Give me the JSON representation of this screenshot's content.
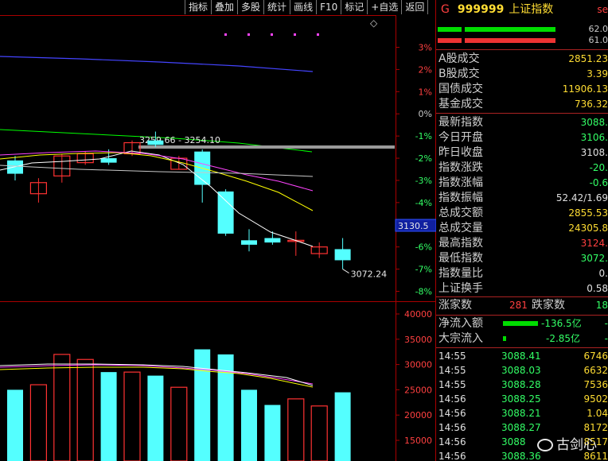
{
  "toolbar": [
    "指标",
    "叠加",
    "多股",
    "统计",
    "画线",
    "F10",
    "标记",
    "+自选",
    "返回"
  ],
  "main_chart": {
    "pct_labels": [
      "3%",
      "2%",
      "1%",
      "0%",
      "-1%",
      "-2%",
      "-3%",
      "-4%",
      "-5%",
      "-6%",
      "-7%",
      "-8%"
    ],
    "range_annotation": "3259.66 - 3254.10",
    "low_annotation": "3072.24",
    "cursor_price": "3130.5",
    "diamond": "◇"
  },
  "volume_chart": {
    "axis_labels": [
      "40000",
      "35000",
      "30000",
      "25000",
      "20000",
      "15000"
    ]
  },
  "colors": {
    "up": "#ff3232",
    "down": "#54ffff",
    "ma5": "#ffffff",
    "ma10": "#ffff00",
    "ma20": "#ff44ff",
    "ma60": "#00ff00",
    "ma_long": "#4444ff",
    "axis": "#aa0000"
  },
  "chart_data": {
    "type": "candlestick",
    "y_axis_pct": {
      "min": -8,
      "max": 3
    },
    "y_axis_volume": {
      "min": 15000,
      "max": 40000
    },
    "candles": [
      {
        "o": -2.1,
        "c": -2.7,
        "h": -1.9,
        "l": -3.0
      },
      {
        "o": -3.6,
        "c": -3.1,
        "h": -2.9,
        "l": -4.0
      },
      {
        "o": -2.8,
        "c": -1.9,
        "h": -1.8,
        "l": -3.1
      },
      {
        "o": -2.2,
        "c": -1.8,
        "h": -1.7,
        "l": -2.3
      },
      {
        "o": -2.0,
        "c": -2.2,
        "h": -1.6,
        "l": -2.3
      },
      {
        "o": -1.8,
        "c": -1.3,
        "h": -1.2,
        "l": -1.9
      },
      {
        "o": -1.2,
        "c": -1.4,
        "h": -0.8,
        "l": -1.5
      },
      {
        "o": -2.5,
        "c": -2.0,
        "h": -1.9,
        "l": -2.5
      },
      {
        "o": -1.7,
        "c": -3.2,
        "h": -1.6,
        "l": -4.0
      },
      {
        "o": -3.5,
        "c": -5.4,
        "h": -3.4,
        "l": -5.5
      },
      {
        "o": -5.7,
        "c": -5.9,
        "h": -5.2,
        "l": -6.2
      },
      {
        "o": -5.6,
        "c": -5.8,
        "h": -5.3,
        "l": -5.9
      },
      {
        "o": -5.7,
        "c": -5.7,
        "h": -5.3,
        "l": -6.4
      },
      {
        "o": -6.3,
        "c": -6.0,
        "h": -5.8,
        "l": -6.5
      },
      {
        "o": -6.1,
        "c": -6.6,
        "h": -5.6,
        "l": -7.0
      }
    ],
    "volumes": [
      {
        "v": 25000,
        "up": false
      },
      {
        "v": 26000,
        "up": true
      },
      {
        "v": 32000,
        "up": true
      },
      {
        "v": 31000,
        "up": true
      },
      {
        "v": 28500,
        "up": false
      },
      {
        "v": 28500,
        "up": true
      },
      {
        "v": 27800,
        "up": false
      },
      {
        "v": 25500,
        "up": true
      },
      {
        "v": 33000,
        "up": false
      },
      {
        "v": 32000,
        "up": false
      },
      {
        "v": 25000,
        "up": false
      },
      {
        "v": 22000,
        "up": false
      },
      {
        "v": 23200,
        "up": true
      },
      {
        "v": 21800,
        "up": true
      },
      {
        "v": 24500,
        "up": false
      }
    ]
  },
  "panel": {
    "flag": "G",
    "code": "999999",
    "name": "上证指数",
    "se": "se",
    "bar1_pct": "62.0",
    "bar2_pct": "61.0",
    "group1": [
      {
        "k": "A股成交",
        "v": "2851.23",
        "c": "#ffdd33"
      },
      {
        "k": "B股成交",
        "v": "3.39",
        "c": "#ffdd33"
      },
      {
        "k": "国债成交",
        "v": "11906.13",
        "c": "#ffdd33"
      },
      {
        "k": "基金成交",
        "v": "736.32",
        "c": "#ffdd33"
      }
    ],
    "group2": [
      {
        "k": "最新指数",
        "v": "3088.",
        "c": "#33ff66"
      },
      {
        "k": "今日开盘",
        "v": "3106.",
        "c": "#33ff66"
      },
      {
        "k": "昨日收盘",
        "v": "3108.",
        "c": "#e0e0e0"
      },
      {
        "k": "指数涨跌",
        "v": "-20.",
        "c": "#33ff66"
      },
      {
        "k": "指数涨幅",
        "v": "-0.6",
        "c": "#33ff66"
      },
      {
        "k": "指数振幅",
        "v": "52.42/1.69",
        "c": "#e0e0e0"
      },
      {
        "k": "总成交额",
        "v": "2855.53",
        "c": "#ffdd33"
      },
      {
        "k": "总成交量",
        "v": "24305.8",
        "c": "#ffdd33"
      },
      {
        "k": "最高指数",
        "v": "3124.",
        "c": "#ff4040"
      },
      {
        "k": "最低指数",
        "v": "3072.",
        "c": "#33ff66"
      },
      {
        "k": "指数量比",
        "v": "0.",
        "c": "#e0e0e0"
      },
      {
        "k": "上证换手",
        "v": "0.58",
        "c": "#e0e0e0"
      }
    ],
    "rise_label": "涨家数",
    "rise_count": "281",
    "fall_label": "跌家数",
    "fall_count": "18",
    "net_inflow_label": "净流入额",
    "net_inflow": "-136.5亿",
    "net_inflow_tail": "-",
    "block_inflow_label": "大宗流入",
    "block_inflow": "-2.85亿",
    "block_inflow_tail": "-",
    "ticks": [
      {
        "time": "14:55",
        "price": "3088.41",
        "vol": "6746"
      },
      {
        "time": "14:55",
        "price": "3088.03",
        "vol": "6632"
      },
      {
        "time": "14:55",
        "price": "3088.28",
        "vol": "7536"
      },
      {
        "time": "14:56",
        "price": "3088.25",
        "vol": "9502"
      },
      {
        "time": "14:56",
        "price": "3088.21",
        "vol": "1.04"
      },
      {
        "time": "14:56",
        "price": "3088.27",
        "vol": "8172"
      },
      {
        "time": "14:56",
        "price": "3088",
        "vol": "8517"
      },
      {
        "time": "14:56",
        "price": "3088.36",
        "vol": "8611"
      }
    ],
    "watermark": "古剑心"
  }
}
